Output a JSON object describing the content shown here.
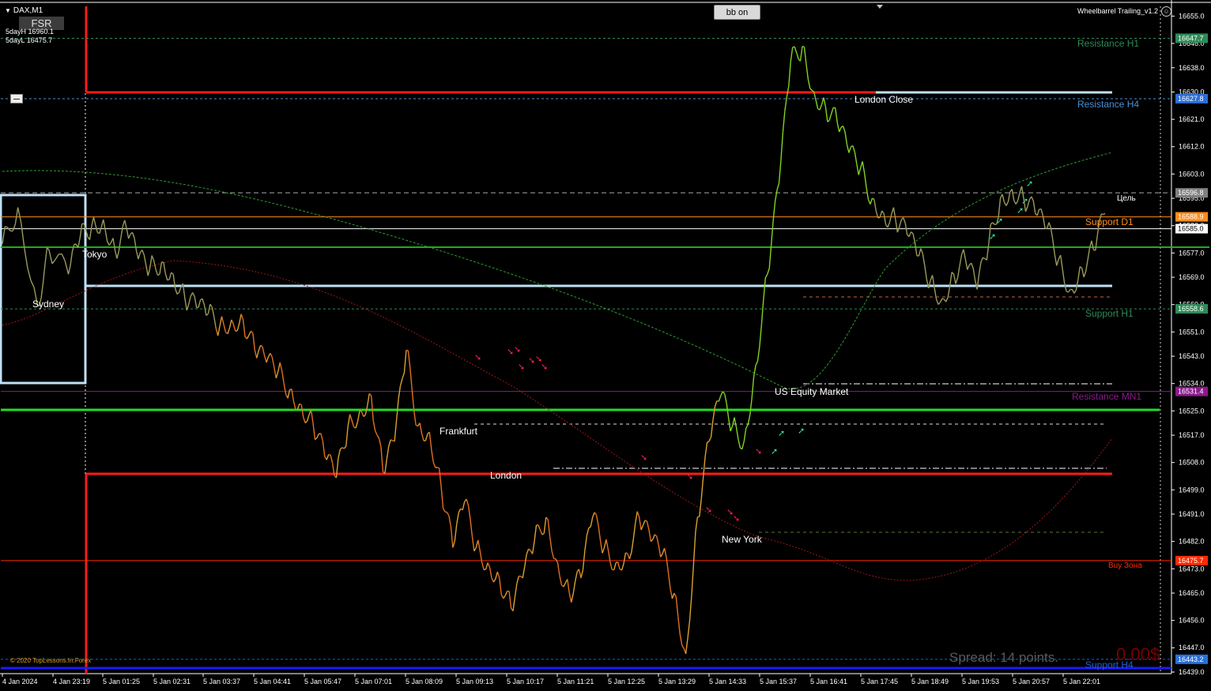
{
  "header": {
    "symbol": "DAX,M1",
    "fsr_label": "FSR",
    "five_day_high": "5dayH 16960.1",
    "five_day_low": "5dayL 16475.7",
    "bb_button": "bb on",
    "ea_name": "Wheelbarrel Trailing_v1.2"
  },
  "footer": {
    "copyright": "© 2020 TopLessons.In.Forex",
    "spread": "Spread: 14 points.",
    "profit": "0.00$"
  },
  "colors": {
    "background": "#000000",
    "up_candle": "#7fd320",
    "down_candle": "#e07020",
    "neutral_candle": "#9a9a5a",
    "axis_text": "#ffffff"
  },
  "chart_data": {
    "type": "line",
    "symbol": "DAX",
    "timeframe": "M1",
    "ylim": [
      16439.0,
      16659.0
    ],
    "y_ticks": [
      16655.0,
      16646.0,
      16638.0,
      16630.0,
      16621.0,
      16612.0,
      16603.0,
      16595.0,
      16586.0,
      16577.0,
      16569.0,
      16560.0,
      16551.0,
      16543.0,
      16534.0,
      16525.0,
      16517.0,
      16508.0,
      16499.0,
      16491.0,
      16482.0,
      16473.0,
      16465.0,
      16456.0,
      16447.0,
      16439.0
    ],
    "x_ticks": [
      "4 Jan 2024",
      "4 Jan 23:19",
      "5 Jan 01:25",
      "5 Jan 02:31",
      "5 Jan 03:37",
      "5 Jan 04:41",
      "5 Jan 05:47",
      "5 Jan 07:01",
      "5 Jan 08:09",
      "5 Jan 09:13",
      "5 Jan 10:17",
      "5 Jan 11:21",
      "5 Jan 12:25",
      "5 Jan 13:29",
      "5 Jan 14:33",
      "5 Jan 15:37",
      "5 Jan 16:41",
      "5 Jan 17:45",
      "5 Jan 18:49",
      "5 Jan 19:53",
      "5 Jan 20:57",
      "5 Jan 22:01"
    ],
    "price_series": [
      [
        0,
        16580
      ],
      [
        4,
        16592
      ],
      [
        9,
        16560
      ],
      [
        12,
        16578
      ],
      [
        17,
        16570
      ],
      [
        20,
        16582
      ],
      [
        23,
        16586
      ],
      [
        26,
        16588
      ],
      [
        29,
        16578
      ],
      [
        32,
        16585
      ],
      [
        35,
        16575
      ],
      [
        38,
        16572
      ],
      [
        41,
        16574
      ],
      [
        44,
        16570
      ],
      [
        47,
        16562
      ],
      [
        50,
        16559
      ],
      [
        53,
        16557
      ],
      [
        56,
        16553
      ],
      [
        59,
        16555
      ],
      [
        62,
        16555
      ],
      [
        65,
        16545
      ],
      [
        68,
        16541
      ],
      [
        71,
        16538
      ],
      [
        74,
        16532
      ],
      [
        77,
        16527
      ],
      [
        80,
        16521
      ],
      [
        83,
        16510
      ],
      [
        86,
        16503
      ],
      [
        89,
        16520
      ],
      [
        92,
        16525
      ],
      [
        95,
        16530
      ],
      [
        98,
        16505
      ],
      [
        101,
        16515
      ],
      [
        104,
        16545
      ],
      [
        107,
        16520
      ],
      [
        110,
        16518
      ],
      [
        113,
        16500
      ],
      [
        116,
        16480
      ],
      [
        119,
        16495
      ],
      [
        122,
        16480
      ],
      [
        125,
        16475
      ],
      [
        128,
        16470
      ],
      [
        131,
        16460
      ],
      [
        134,
        16470
      ],
      [
        137,
        16482
      ],
      [
        140,
        16490
      ],
      [
        143,
        16475
      ],
      [
        146,
        16465
      ],
      [
        149,
        16470
      ],
      [
        152,
        16490
      ],
      [
        155,
        16480
      ],
      [
        158,
        16475
      ],
      [
        161,
        16478
      ],
      [
        164,
        16490
      ],
      [
        167,
        16482
      ],
      [
        170,
        16478
      ],
      [
        173,
        16465
      ],
      [
        176,
        16445
      ],
      [
        179,
        16490
      ],
      [
        182,
        16515
      ],
      [
        185,
        16530
      ],
      [
        188,
        16520
      ],
      [
        191,
        16515
      ],
      [
        194,
        16540
      ],
      [
        197,
        16570
      ],
      [
        200,
        16600
      ],
      [
        203,
        16640
      ],
      [
        206,
        16645
      ],
      [
        209,
        16630
      ],
      [
        212,
        16625
      ],
      [
        215,
        16620
      ],
      [
        218,
        16610
      ],
      [
        221,
        16605
      ],
      [
        224,
        16595
      ],
      [
        227,
        16590
      ],
      [
        230,
        16588
      ],
      [
        233,
        16583
      ],
      [
        236,
        16576
      ],
      [
        239,
        16568
      ],
      [
        242,
        16562
      ],
      [
        245,
        16570
      ],
      [
        248,
        16575
      ],
      [
        251,
        16565
      ],
      [
        254,
        16580
      ],
      [
        257,
        16595
      ],
      [
        260,
        16598
      ],
      [
        263,
        16595
      ],
      [
        266,
        16590
      ],
      [
        269,
        16585
      ],
      [
        272,
        16575
      ],
      [
        275,
        16565
      ],
      [
        278,
        16572
      ],
      [
        281,
        16578
      ],
      [
        284,
        16590
      ]
    ],
    "price_series_x_note": "",
    "levels": [
      {
        "label": "Resistance H1",
        "value": 16647.7,
        "color": "#2e8b57"
      },
      {
        "label": "Resistance H4",
        "value": 16627.8,
        "color": "#4a90d9"
      },
      {
        "label": "Цель",
        "value": 16596.8,
        "color": "#aaaaaa"
      },
      {
        "label": "Support D1",
        "value": 16588.9,
        "color": "#ff8c1a"
      },
      {
        "label": "",
        "value": 16585.0,
        "color": "#ffffff"
      },
      {
        "label": "Support H1",
        "value": 16558.6,
        "color": "#2e8b57"
      },
      {
        "label": "Resistance MN1",
        "value": 16531.4,
        "color": "#8b1a8b"
      },
      {
        "label": "Buy Зона",
        "value": 16475.7,
        "color": "#ff2a00"
      },
      {
        "label": "Support H4",
        "value": 16443.2,
        "color": "#2060d0"
      }
    ],
    "price_tags": [
      {
        "text": "16647.7",
        "value": 16647.7,
        "bg": "#2e8b57"
      },
      {
        "text": "16627.8",
        "value": 16627.8,
        "bg": "#2a6fd6"
      },
      {
        "text": "16596.8",
        "value": 16596.8,
        "bg": "#808080"
      },
      {
        "text": "16588.9",
        "value": 16588.9,
        "bg": "#ff8c1a"
      },
      {
        "text": "16585.0",
        "value": 16585.0,
        "bg": "#ffffff"
      },
      {
        "text": "16558.6",
        "value": 16558.6,
        "bg": "#2e8b57"
      },
      {
        "text": "16531.4",
        "value": 16531.4,
        "bg": "#8b1a8b"
      },
      {
        "text": "16475.7",
        "value": 16475.7,
        "bg": "#ff2a00"
      },
      {
        "text": "16443.2",
        "value": 16443.2,
        "bg": "#2a6fd6"
      }
    ],
    "sessions": [
      "Sydney",
      "Tokyo",
      "Frankfurt",
      "London",
      "New York",
      "US Equity Market",
      "London Close"
    ]
  }
}
